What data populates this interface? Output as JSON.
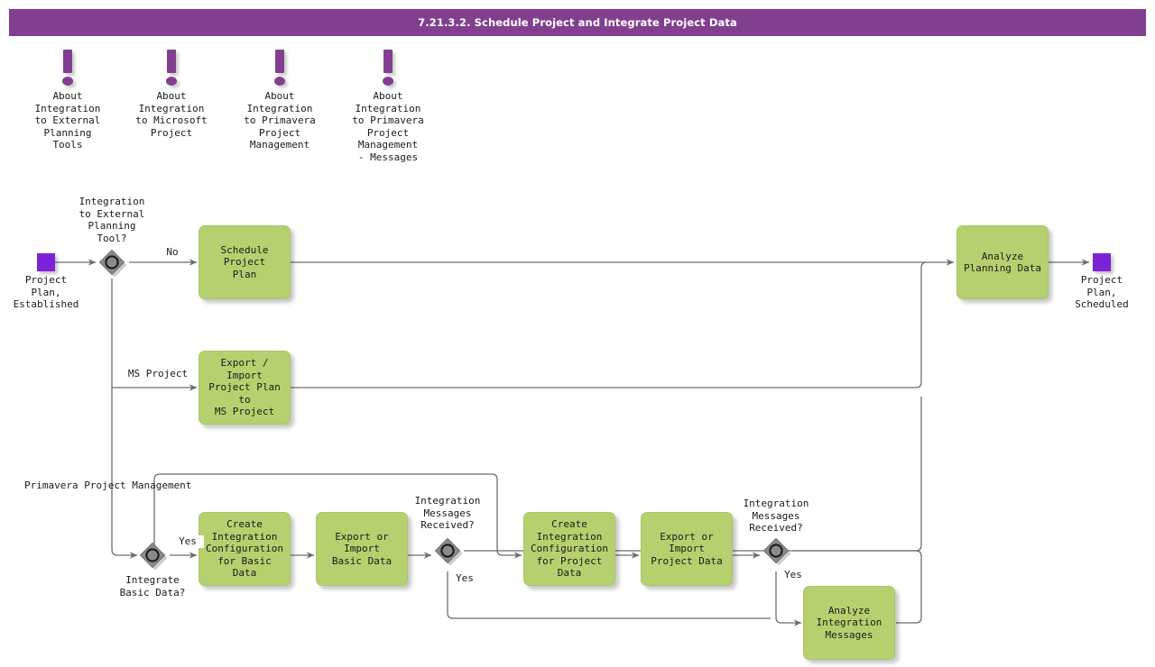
{
  "header": {
    "title": "7.21.3.2. Schedule Project and Integrate Project Data",
    "bar_color": "#833F8F"
  },
  "palette": {
    "task_fill": "#B5D16F",
    "event_fill": "#7D22D6",
    "gateway_fill": "#8A8A8A",
    "connector": "#6E6E6E",
    "annotation": "#833F8F"
  },
  "annotations": [
    {
      "id": "annot-external-planning-tools",
      "icon": "information-exclamation-icon",
      "label": "About\nIntegration\nto External\nPlanning\nTools"
    },
    {
      "id": "annot-microsoft-project",
      "icon": "information-exclamation-icon",
      "label": "About\nIntegration\nto Microsoft\nProject"
    },
    {
      "id": "annot-primavera",
      "icon": "information-exclamation-icon",
      "label": "About\nIntegration\nto Primavera\nProject\nManagement"
    },
    {
      "id": "annot-primavera-messages",
      "icon": "information-exclamation-icon",
      "label": "About\nIntegration\nto Primavera\nProject\nManagement\n- Messages"
    }
  ],
  "events": [
    {
      "id": "event-start",
      "label": "Project\nPlan,\nEstablished"
    },
    {
      "id": "event-end",
      "label": "Project\nPlan,\nScheduled"
    }
  ],
  "gateways": [
    {
      "id": "gateway-integration-external-tool",
      "label": "Integration\nto External\nPlanning\nTool?"
    },
    {
      "id": "gateway-integrate-basic-data",
      "label": "Integrate\nBasic Data?"
    },
    {
      "id": "gateway-messages-basic",
      "label": "Integration\nMessages\nReceived?"
    },
    {
      "id": "gateway-messages-project",
      "label": "Integration\nMessages\nReceived?"
    }
  ],
  "tasks": [
    {
      "id": "task-schedule-project-plan",
      "label": "Schedule Project\nPlan"
    },
    {
      "id": "task-export-import-ms-project",
      "label": "Export / Import\nProject Plan to\nMS Project"
    },
    {
      "id": "task-create-config-basic",
      "label": "Create\nIntegration\nConfiguration\nfor Basic Data"
    },
    {
      "id": "task-export-import-basic-data",
      "label": "Export or Import\nBasic Data"
    },
    {
      "id": "task-create-config-project",
      "label": "Create\nIntegration\nConfiguration\nfor Project Data"
    },
    {
      "id": "task-export-import-project-data",
      "label": "Export or Import\nProject Data"
    },
    {
      "id": "task-analyze-integration-messages",
      "label": "Analyze\nIntegration\nMessages"
    },
    {
      "id": "task-analyze-planning-data",
      "label": "Analyze\nPlanning Data"
    }
  ],
  "flow_labels": [
    {
      "id": "flow-label-no",
      "text": "No"
    },
    {
      "id": "flow-label-ms-project",
      "text": "MS Project"
    },
    {
      "id": "flow-label-primavera",
      "text": "Primavera\nProject\nManagement"
    },
    {
      "id": "flow-label-yes-basic",
      "text": "Yes"
    },
    {
      "id": "flow-label-yes-messages-basic",
      "text": "Yes"
    },
    {
      "id": "flow-label-yes-messages-project",
      "text": "Yes"
    }
  ]
}
